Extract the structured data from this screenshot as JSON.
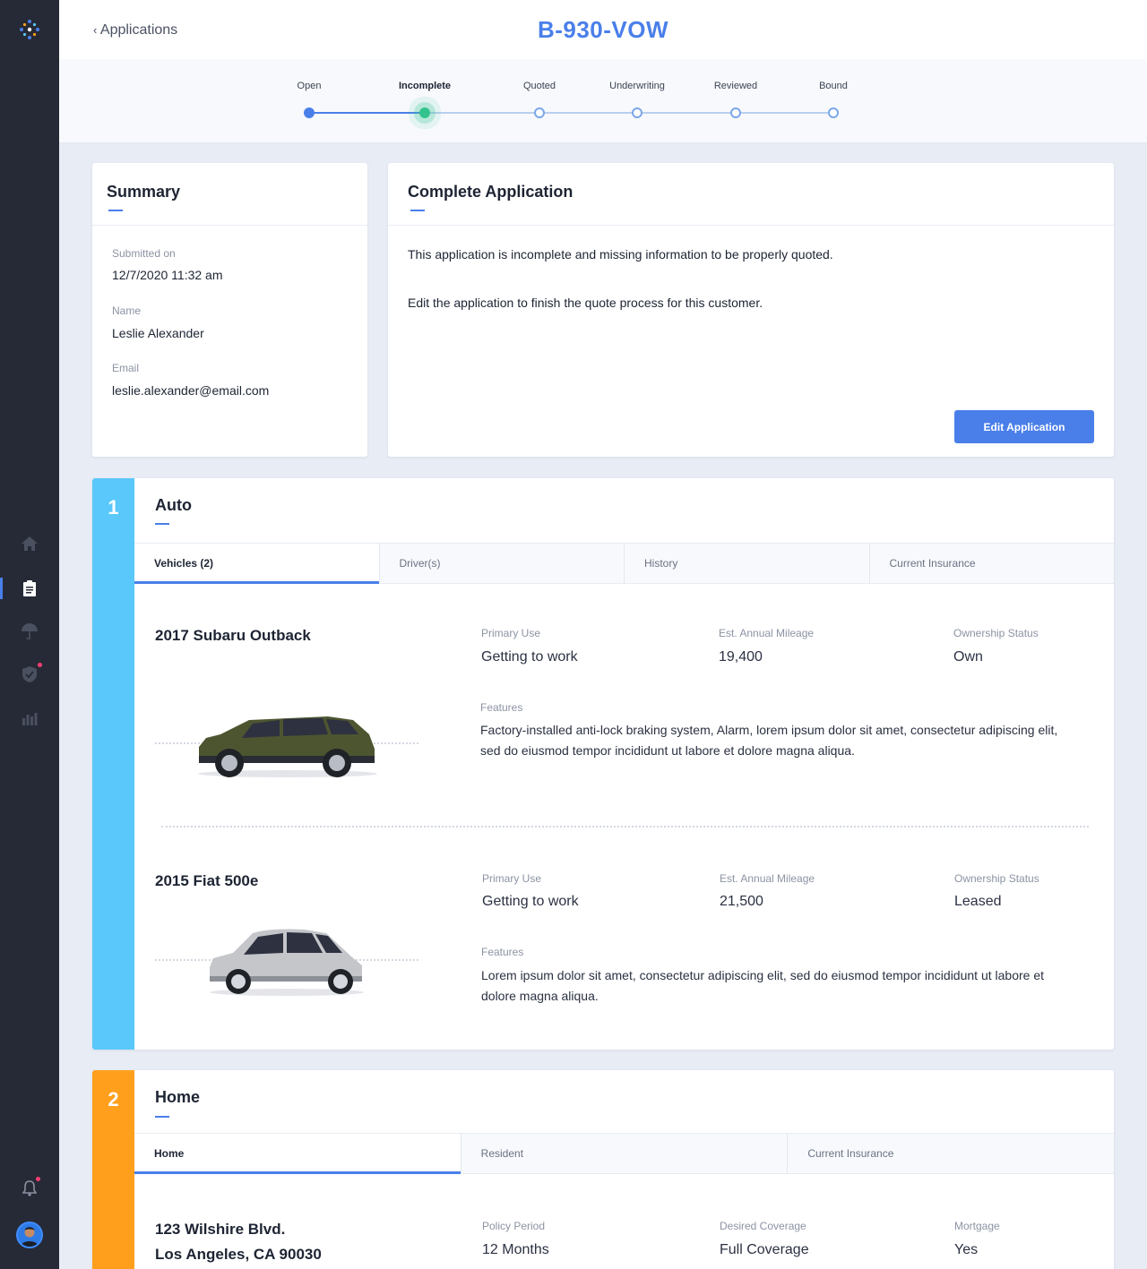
{
  "header": {
    "back_label": "Applications",
    "title": "B-930-VOW"
  },
  "stepper": {
    "steps": [
      "Open",
      "Incomplete",
      "Quoted",
      "Underwriting",
      "Reviewed",
      "Bound"
    ],
    "current": "Incomplete"
  },
  "summary": {
    "title": "Summary",
    "submitted_label": "Submitted on",
    "submitted_value": "12/7/2020 11:32 am",
    "name_label": "Name",
    "name_value": "Leslie Alexander",
    "email_label": "Email",
    "email_value": "leslie.alexander@email.com"
  },
  "complete": {
    "title": "Complete Application",
    "line1": "This application is incomplete and missing information to be properly quoted.",
    "line2": "Edit the application to finish the quote process for this customer.",
    "button": "Edit Application"
  },
  "auto": {
    "number": "1",
    "title": "Auto",
    "tabs": [
      "Vehicles (2)",
      "Driver(s)",
      "History",
      "Current Insurance"
    ],
    "vehicles": [
      {
        "name": "2017 Subaru Outback",
        "primary_use_label": "Primary Use",
        "primary_use": "Getting to work",
        "mileage_label": "Est. Annual Mileage",
        "mileage": "19,400",
        "ownership_label": "Ownership Status",
        "ownership": "Own",
        "features_label": "Features",
        "features": "Factory-installed anti-lock braking system, Alarm, lorem ipsum dolor sit amet, consectetur adipiscing elit, sed do eiusmod tempor incididunt ut labore et dolore magna aliqua."
      },
      {
        "name": "2015 Fiat 500e",
        "primary_use_label": "Primary Use",
        "primary_use": "Getting to work",
        "mileage_label": "Est. Annual Mileage",
        "mileage": "21,500",
        "ownership_label": "Ownership Status",
        "ownership": "Leased",
        "features_label": "Features",
        "features": "Lorem ipsum dolor sit amet, consectetur adipiscing elit, sed do eiusmod tempor incididunt ut labore et dolore magna aliqua."
      }
    ]
  },
  "home": {
    "number": "2",
    "title": "Home",
    "tabs": [
      "Home",
      "Resident",
      "Current Insurance"
    ],
    "address_line1": "123 Wilshire Blvd.",
    "address_line2": "Los Angeles, CA 90030",
    "policy_label": "Policy Period",
    "policy": "12 Months",
    "coverage_label": "Desired Coverage",
    "coverage": "Full Coverage",
    "mortgage_label": "Mortgage",
    "mortgage": "Yes"
  },
  "colors": {
    "accent": "#4a7fea",
    "auto_band": "#5ac8fa",
    "home_band": "#ff9f1c",
    "sidebar": "#262a36"
  }
}
